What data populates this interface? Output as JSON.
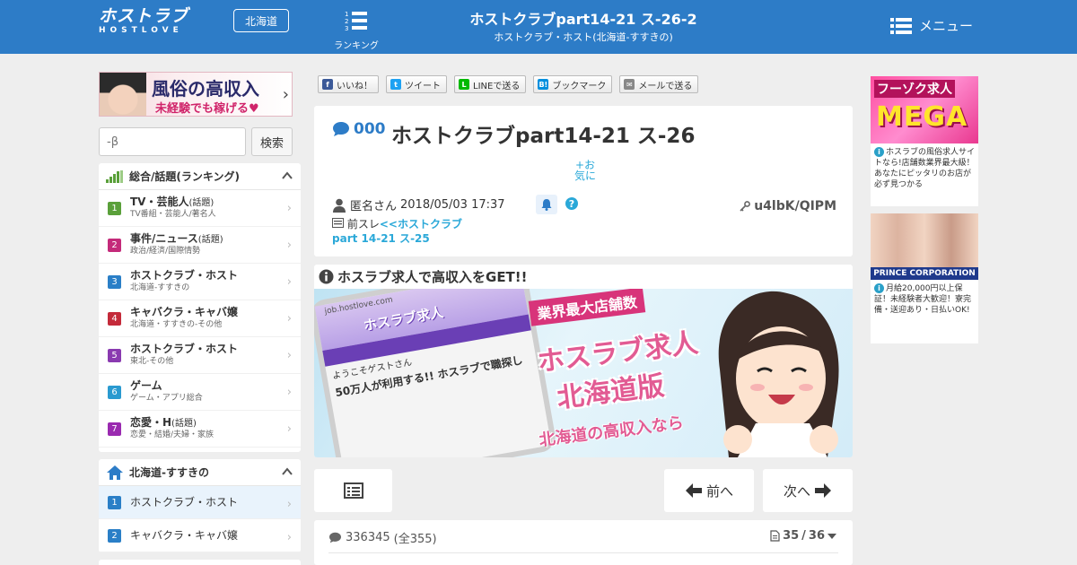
{
  "header": {
    "logo_main": "ホストラブ",
    "logo_sub": "HOSTLOVE",
    "area_label": "北海道",
    "ranking_label": "ランキング",
    "title": "ホストクラブpart14-21 ス-26-2",
    "subtitle": "ホストクラブ・ホスト(北海道-すすきの)",
    "menu_label": "メニュー"
  },
  "left_banner": {
    "line1": "風俗の高収入",
    "line2": "未経験でも稼げる♥"
  },
  "search": {
    "placeholder": "-β",
    "button": "検索"
  },
  "ranking_panel": {
    "title": "総合/話題(ランキング)",
    "items": [
      {
        "num": "1",
        "title": "TV・芸能人",
        "tag": "(話題)",
        "sub": "TV番組・芸能人/著名人",
        "color": "#5aa03a"
      },
      {
        "num": "2",
        "title": "事件/ニュース",
        "tag": "(話題)",
        "sub": "政治/経済/国際情勢",
        "color": "#c42a7a"
      },
      {
        "num": "3",
        "title": "ホストクラブ・ホスト",
        "tag": "",
        "sub": "北海道-すすきの",
        "color": "#2a7fc7"
      },
      {
        "num": "4",
        "title": "キャバクラ・キャバ嬢",
        "tag": "",
        "sub": "北海道・すすきの-その他",
        "color": "#c42a3a"
      },
      {
        "num": "5",
        "title": "ホストクラブ・ホスト",
        "tag": "",
        "sub": "東北-その他",
        "color": "#8a3ab0"
      },
      {
        "num": "6",
        "title": "ゲーム",
        "tag": "",
        "sub": "ゲーム・アプリ総合",
        "color": "#2a9ad0"
      },
      {
        "num": "7",
        "title": "恋愛・H",
        "tag": "(話題)",
        "sub": "恋愛・結婚/夫婦・家族",
        "color": "#9a2ab0"
      }
    ]
  },
  "area_panel": {
    "title": "北海道-すすきの",
    "items": [
      {
        "num": "1",
        "title": "ホストクラブ・ホスト",
        "color": "#2a7fc7"
      },
      {
        "num": "2",
        "title": "キャバクラ・キャバ嬢",
        "color": "#2a7fc7"
      }
    ]
  },
  "share": [
    {
      "label": "いいね！",
      "icon": "f",
      "color": "#3b5998"
    },
    {
      "label": "ツイート",
      "icon": "t",
      "color": "#1da1f2"
    },
    {
      "label": "LINEで送る",
      "icon": "L",
      "color": "#00b900"
    },
    {
      "label": "ブックマーク",
      "icon": "B!",
      "color": "#008fde"
    },
    {
      "label": "メールで送る",
      "icon": "✉",
      "color": "#888888"
    }
  ],
  "thread": {
    "comment_count": "000",
    "title": "ホストクラブpart14-21 ス-26",
    "fav_line1": "+お",
    "fav_line2": "気に",
    "user": "匿名さん",
    "date": "2018/05/03 17:37",
    "id": "u4lbK/QIPM",
    "prev_label": "前スレ",
    "prev_link": "<<ホストクラブpart 14-21 ス-25"
  },
  "ad": {
    "header": "ホスラブ求人で高収入をGET!!",
    "phone_site": "job.hostlove.com",
    "phone_welcome": "ようこそゲストさん",
    "phone_big": "50万人が利用する!! ホスラブで職探し",
    "copy1": "業界最大店舗数",
    "copy2": "ホスラブ求人",
    "copy3": "北海道版",
    "copy4": "北海道の高収入なら"
  },
  "nav": {
    "prev": "前へ",
    "next": "次へ"
  },
  "res_bar": {
    "count": "336345",
    "sub": "(全355)",
    "page_current": "35",
    "page_total": "36"
  },
  "right_ads": [
    {
      "banner1": "フーゾク求人",
      "banner2": "MEGA",
      "text": "ホスラブの風俗求人サイトなら!店舗数業界最大級！あなたにピッタリのお店が必ず見つかる"
    },
    {
      "banner": "PRINCE CORPORATION",
      "text": "月給20,000円以上保証！未経験者大歓迎！寮完備・送迎あり・日払いOK!"
    }
  ]
}
